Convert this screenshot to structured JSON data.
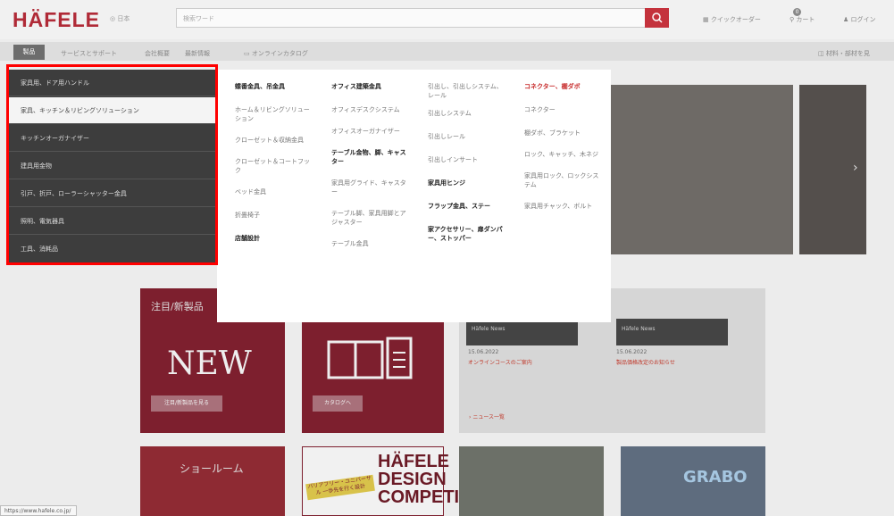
{
  "header": {
    "logo": "HÄFELE",
    "lang": "日本",
    "search_placeholder": "検索ワード",
    "quick_order": "クイックオーダー",
    "cart": "カート",
    "cart_count": "0",
    "login": "ログイン"
  },
  "nav": {
    "products": "製品",
    "items": [
      "サービスとサポート",
      "会社概要",
      "最新情報",
      "オンラインカタログ"
    ],
    "right": "材料・部材を見"
  },
  "categories": [
    "家具用、ドア用ハンドル",
    "家具、キッチン＆リビングソリューション",
    "キッチンオーガナイザー",
    "建具用金物",
    "引戸、折戸、ローラーシャッター金具",
    "照明、電気器具",
    "工具、消耗品"
  ],
  "menu": {
    "col1": [
      "蝶番金具、吊金具",
      "ホーム＆リビングソリューション",
      "クローゼット＆収納金具",
      "クローゼット＆コートフック",
      "ベッド金具",
      "折畳椅子",
      "店舗設計"
    ],
    "col2": [
      "オフィス建築金具",
      "オフィスデスクシステム",
      "オフィスオーガナイザー",
      "テーブル金物、脚、キャスター",
      "家具用グライド、キャスター",
      "テーブル脚、家具用脚とアジャスター",
      "テーブル金具"
    ],
    "col3": [
      "引出し、引出しシステム、レール",
      "引出しシステム",
      "引出しレール",
      "引出しインサート",
      "家具用ヒンジ",
      "フラップ金具、ステー",
      "家アクセサリー、扉ダンパー、ストッパー"
    ],
    "col4": [
      "コネクター、棚ダボ",
      "コネクター",
      "棚ダボ、ブラケット",
      "ロック、キャッチ、木ネジ",
      "家具用ロック、ロックシステム",
      "家具用チャック、ボルト"
    ]
  },
  "tiles": {
    "news_title": "注目/新製品",
    "news_big": "NEW",
    "news_btn": "注目/新製品を見る",
    "catalog_btn": "カタログへ",
    "hn1_label": "Häfele News",
    "hn1_date": "15.06.2022",
    "hn1_link": "オンラインコースのご案内",
    "hn2_label": "Häfele News",
    "hn2_date": "15.06.2022",
    "hn2_link": "製品価格改定のお知らせ",
    "news_more": "ニュース一覧",
    "showroom": "ショールーム",
    "design_banner": "バリアフリー・ユニバーサル 一歩先を行く設計",
    "design_big": "HÄFELE DESIGN COMPETITION",
    "grabo": "GRABO"
  },
  "status_url": "https://www.hafele.co.jp/"
}
